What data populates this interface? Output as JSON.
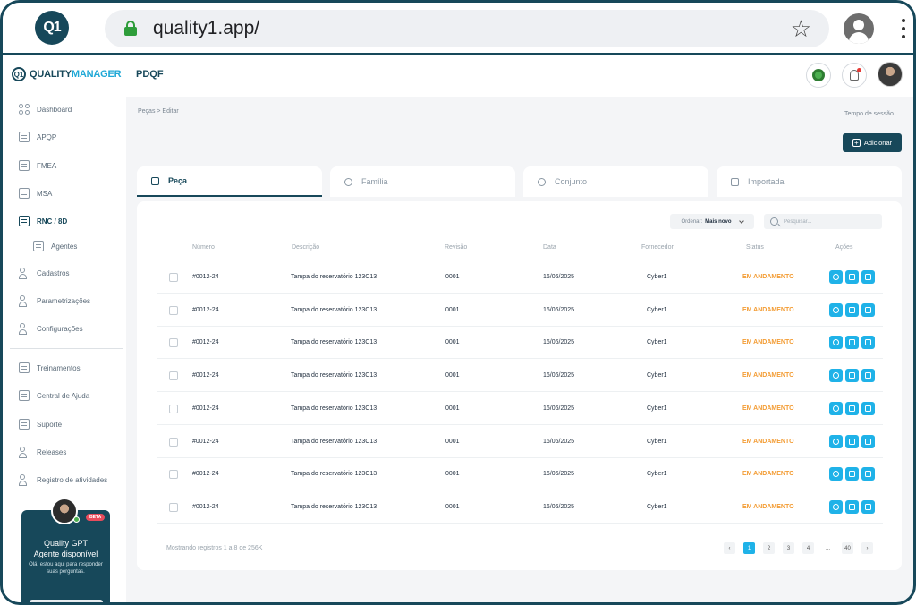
{
  "browser": {
    "url": "quality1.app/",
    "logo_text": "Q1"
  },
  "app": {
    "brand_prefix": "QUALITY",
    "brand_suffix": "MANAGER",
    "title": "PDQF"
  },
  "sidebar": {
    "items": [
      {
        "label": "Dashboard"
      },
      {
        "label": "APQP"
      },
      {
        "label": "FMEA"
      },
      {
        "label": "MSA"
      },
      {
        "label": "RNC / 8D"
      },
      {
        "label": "Cadastros"
      },
      {
        "label": "Parametrizações"
      },
      {
        "label": "Configurações"
      },
      {
        "label": "Treinamentos"
      },
      {
        "label": "Central de Ajuda"
      },
      {
        "label": "Suporte"
      },
      {
        "label": "Releases"
      },
      {
        "label": "Registro de atividades"
      }
    ],
    "sub_item": "Agentes",
    "gpt_card": {
      "badge": "BETA",
      "title_line1": "Quality GPT",
      "title_line2": "Agente disponível",
      "desc": "Olá, estou aqui para responder suas perguntas."
    }
  },
  "content": {
    "breadcrumb": "Peças > Editar",
    "session": "Tempo de sessão",
    "add_button": "Adicionar",
    "tabs": [
      {
        "label": "Peça"
      },
      {
        "label": "Família"
      },
      {
        "label": "Conjunto"
      },
      {
        "label": "Importada"
      }
    ],
    "sort_label": "Ordenar:",
    "sort_value": "Mais novo",
    "search_placeholder": "Pesquisar...",
    "columns": [
      "Número",
      "Descrição",
      "Revisão",
      "Data",
      "Fornecedor",
      "Status",
      "Ações"
    ],
    "rows": [
      {
        "numero": "#0012-24",
        "descricao": "Tampa do reservatório 123C13",
        "revisao": "0001",
        "data": "16/06/2025",
        "fornecedor": "Cyber1",
        "status": "EM ANDAMENTO"
      },
      {
        "numero": "#0012-24",
        "descricao": "Tampa do reservatório 123C13",
        "revisao": "0001",
        "data": "16/06/2025",
        "fornecedor": "Cyber1",
        "status": "EM ANDAMENTO"
      },
      {
        "numero": "#0012-24",
        "descricao": "Tampa do reservatório 123C13",
        "revisao": "0001",
        "data": "16/06/2025",
        "fornecedor": "Cyber1",
        "status": "EM ANDAMENTO"
      },
      {
        "numero": "#0012-24",
        "descricao": "Tampa do reservatório 123C13",
        "revisao": "0001",
        "data": "16/06/2025",
        "fornecedor": "Cyber1",
        "status": "EM ANDAMENTO"
      },
      {
        "numero": "#0012-24",
        "descricao": "Tampa do reservatório 123C13",
        "revisao": "0001",
        "data": "16/06/2025",
        "fornecedor": "Cyber1",
        "status": "EM ANDAMENTO"
      },
      {
        "numero": "#0012-24",
        "descricao": "Tampa do reservatório 123C13",
        "revisao": "0001",
        "data": "16/06/2025",
        "fornecedor": "Cyber1",
        "status": "EM ANDAMENTO"
      },
      {
        "numero": "#0012-24",
        "descricao": "Tampa do reservatório 123C13",
        "revisao": "0001",
        "data": "16/06/2025",
        "fornecedor": "Cyber1",
        "status": "EM ANDAMENTO"
      },
      {
        "numero": "#0012-24",
        "descricao": "Tampa do reservatório 123C13",
        "revisao": "0001",
        "data": "16/06/2025",
        "fornecedor": "Cyber1",
        "status": "EM ANDAMENTO"
      }
    ],
    "footer": "Mostrando registros 1 a 8 de  256K",
    "pagination": {
      "prev": "‹",
      "pages": [
        "1",
        "2",
        "3",
        "4"
      ],
      "ellipsis": "...",
      "last": "40",
      "next": "›"
    }
  },
  "colors": {
    "primary": "#17485a",
    "accent": "#1fb2e8",
    "status": "#f39c34"
  }
}
